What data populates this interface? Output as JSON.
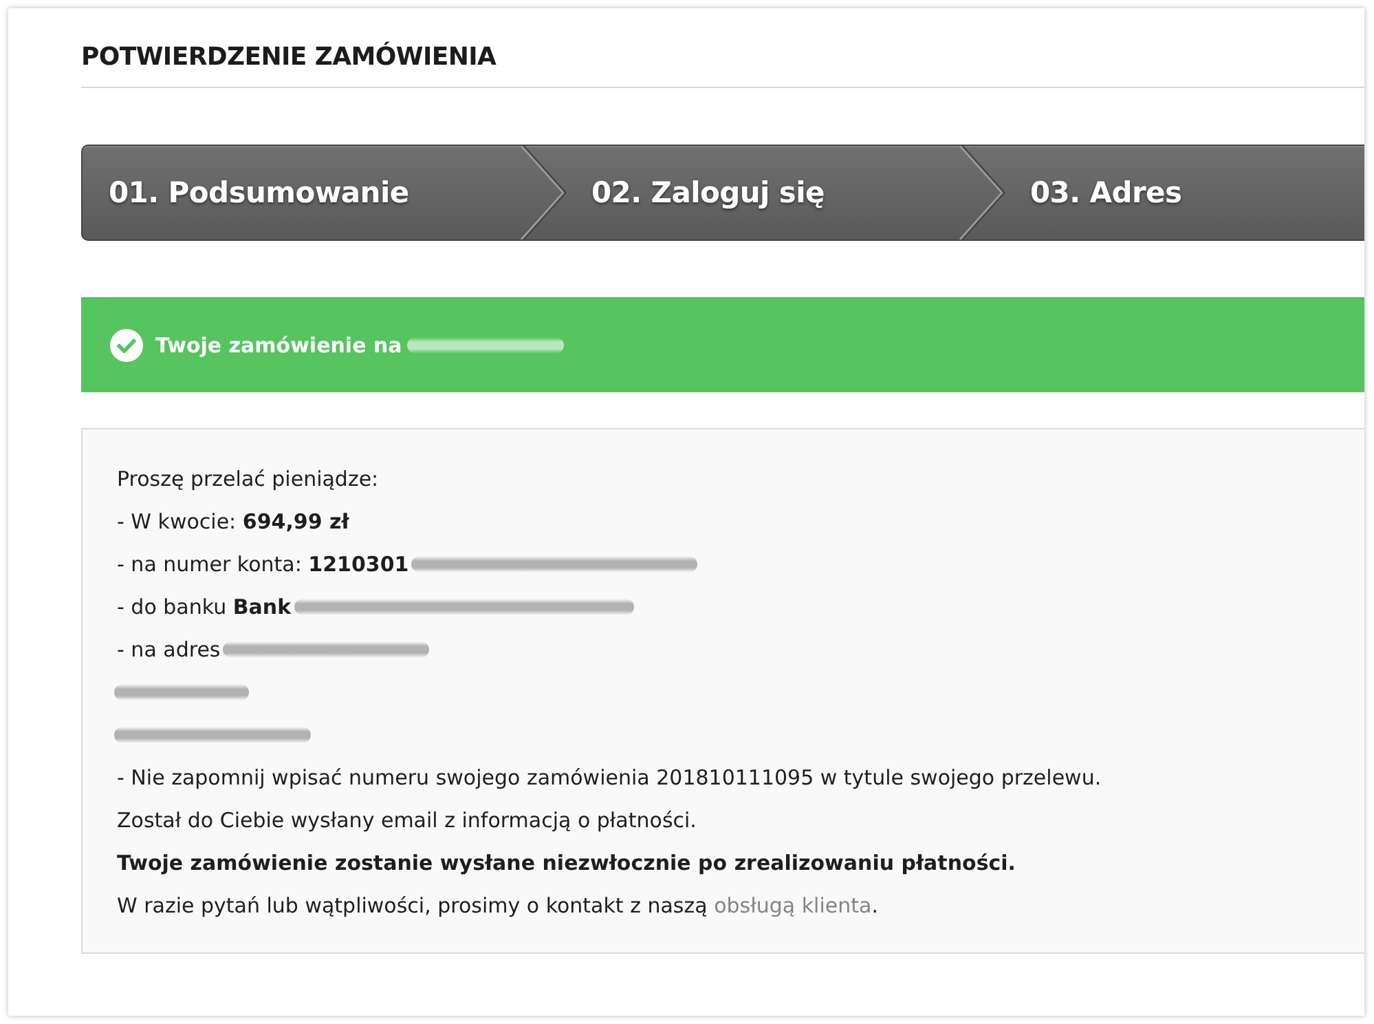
{
  "title": "POTWIERDZENIE ZAMÓWIENIA",
  "steps": [
    "01. Podsumowanie",
    "02. Zaloguj się",
    "03. Adres"
  ],
  "alert": {
    "text": "Twoje zamówienie na",
    "blurred": true
  },
  "payment_info": {
    "lines": [
      {
        "kind": "text",
        "text": "Proszę przelać pieniądze:",
        "blurred": false
      },
      {
        "kind": "text",
        "text": "- W kwocie: **694,99 zł**",
        "blurred": false
      },
      {
        "kind": "text",
        "text": "- na numer konta: **1210301**",
        "blurred": true
      },
      {
        "kind": "text",
        "text": "- do banku **Bank**",
        "blurred": true
      },
      {
        "kind": "text",
        "text": "- na adres",
        "blurred": true
      },
      {
        "kind": "redacted",
        "blurred": true
      },
      {
        "kind": "redacted",
        "blurred": true
      },
      {
        "kind": "text",
        "text": "- Nie zapomnij wpisać numeru swojego zamówienia 201810111095 w tytule swojego przelewu.",
        "blurred": false
      },
      {
        "kind": "text",
        "text": "Został do Ciebie wysłany email z informacją o płatności.",
        "blurred": false
      },
      {
        "kind": "bold",
        "text": "Twoje zamówienie zostanie wysłane niezwłocznie po zrealizowaniu płatności.",
        "blurred": false
      },
      {
        "kind": "link",
        "text": "W razie pytań lub wątpliwości, prosimy o kontakt z naszą ",
        "link": "obsługą klienta",
        "after": ".",
        "blurred": false
      }
    ]
  }
}
